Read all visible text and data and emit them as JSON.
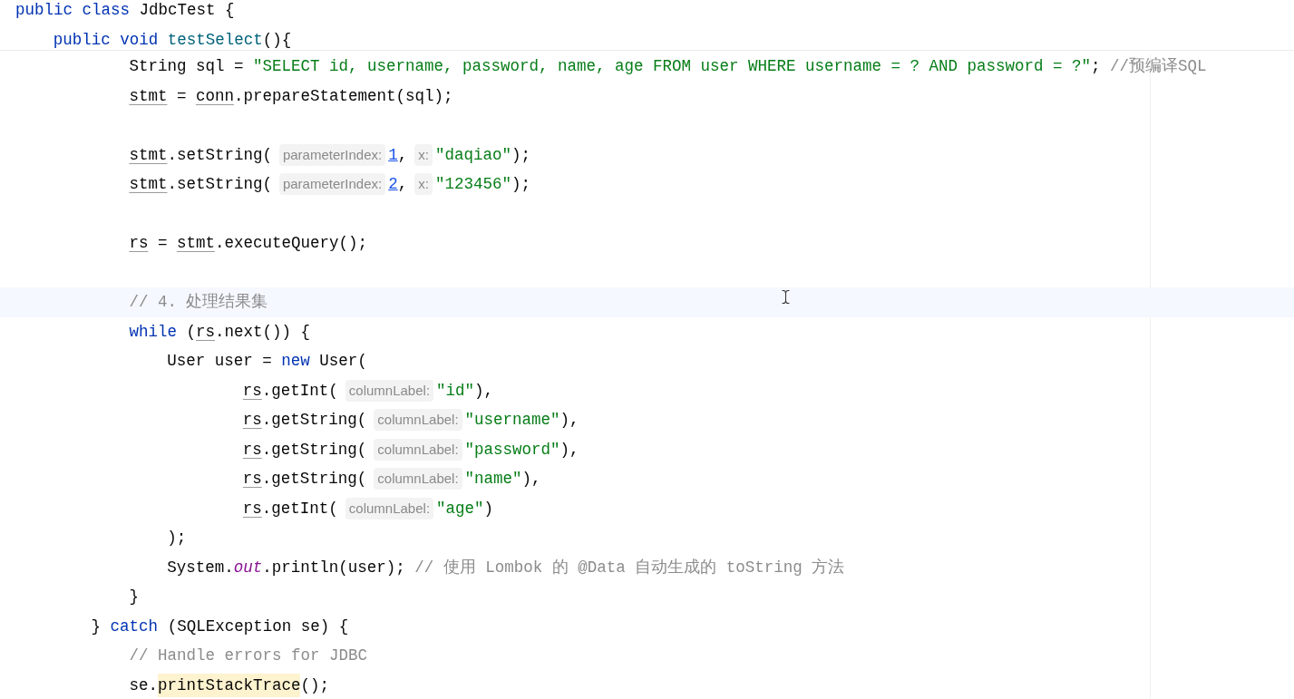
{
  "sticky_header": [
    {
      "kind": "code",
      "tokens": [
        {
          "kind": "kw",
          "text": "public class"
        },
        {
          "kind": "txt",
          "text": " JdbcTest {"
        }
      ],
      "children": [
        {
          "kind": "code",
          "tokens": [
            {
              "kind": "kw",
              "text": "public void "
            },
            {
              "kind": "fn",
              "text": "testSelect"
            },
            {
              "kind": "txt",
              "text": "(){"
            }
          ]
        }
      ]
    }
  ],
  "code": [
    {
      "kind": "group",
      "children": [
        {
          "kind": "code",
          "current": false,
          "tokens": [
            {
              "kind": "txt",
              "text": "String sql = "
            },
            {
              "kind": "str",
              "text": "\"SELECT id, username, password, name, age FROM user WHERE username = ? AND password = ?\""
            },
            {
              "kind": "txt",
              "text": "; "
            },
            {
              "kind": "cmt",
              "text": "//预编译SQL"
            }
          ]
        },
        {
          "kind": "code",
          "current": false,
          "tokens": [
            {
              "kind": "var",
              "text": "stmt"
            },
            {
              "kind": "txt",
              "text": " = "
            },
            {
              "kind": "var",
              "text": "conn"
            },
            {
              "kind": "txt",
              "text": ".prepareStatement(sql);"
            }
          ]
        },
        {
          "kind": "blank"
        },
        {
          "kind": "code",
          "current": false,
          "tokens": [
            {
              "kind": "var",
              "text": "stmt"
            },
            {
              "kind": "txt",
              "text": ".setString("
            },
            {
              "kind": "hint",
              "text": "parameterIndex:"
            },
            {
              "kind": "num",
              "text": "1"
            },
            {
              "kind": "txt",
              "text": ","
            },
            {
              "kind": "hint",
              "text": "x:"
            },
            {
              "kind": "str",
              "text": "\"daqiao\""
            },
            {
              "kind": "txt",
              "text": ");"
            }
          ]
        },
        {
          "kind": "code",
          "current": false,
          "tokens": [
            {
              "kind": "var",
              "text": "stmt"
            },
            {
              "kind": "txt",
              "text": ".setString("
            },
            {
              "kind": "hint",
              "text": "parameterIndex:"
            },
            {
              "kind": "num",
              "text": "2"
            },
            {
              "kind": "txt",
              "text": ","
            },
            {
              "kind": "hint",
              "text": "x:"
            },
            {
              "kind": "str",
              "text": "\"123456\""
            },
            {
              "kind": "txt",
              "text": ");"
            }
          ]
        },
        {
          "kind": "blank"
        },
        {
          "kind": "code",
          "current": false,
          "tokens": [
            {
              "kind": "var",
              "text": "rs"
            },
            {
              "kind": "txt",
              "text": " = "
            },
            {
              "kind": "var",
              "text": "stmt"
            },
            {
              "kind": "txt",
              "text": ".executeQuery();"
            }
          ]
        },
        {
          "kind": "blank"
        },
        {
          "kind": "code",
          "current": true,
          "tokens": [
            {
              "kind": "cmt",
              "text": "// 4. 处理结果集"
            }
          ]
        },
        {
          "kind": "code",
          "current": false,
          "tokens": [
            {
              "kind": "kw",
              "text": "while"
            },
            {
              "kind": "txt",
              "text": " ("
            },
            {
              "kind": "var",
              "text": "rs"
            },
            {
              "kind": "txt",
              "text": ".next()) {"
            }
          ],
          "children": [
            {
              "kind": "code",
              "current": false,
              "tokens": [
                {
                  "kind": "txt",
                  "text": "User user = "
                },
                {
                  "kind": "kw",
                  "text": "new"
                },
                {
                  "kind": "txt",
                  "text": " User("
                }
              ],
              "children": [
                {
                  "kind": "group",
                  "children": [
                    {
                      "kind": "code",
                      "current": false,
                      "tokens": [
                        {
                          "kind": "var",
                          "text": "rs"
                        },
                        {
                          "kind": "txt",
                          "text": ".getInt("
                        },
                        {
                          "kind": "hint",
                          "text": "columnLabel:"
                        },
                        {
                          "kind": "str",
                          "text": "\"id\""
                        },
                        {
                          "kind": "txt",
                          "text": "),"
                        }
                      ]
                    },
                    {
                      "kind": "code",
                      "current": false,
                      "tokens": [
                        {
                          "kind": "var",
                          "text": "rs"
                        },
                        {
                          "kind": "txt",
                          "text": ".getString("
                        },
                        {
                          "kind": "hint",
                          "text": "columnLabel:"
                        },
                        {
                          "kind": "str",
                          "text": "\"username\""
                        },
                        {
                          "kind": "txt",
                          "text": "),"
                        }
                      ]
                    },
                    {
                      "kind": "code",
                      "current": false,
                      "tokens": [
                        {
                          "kind": "var",
                          "text": "rs"
                        },
                        {
                          "kind": "txt",
                          "text": ".getString("
                        },
                        {
                          "kind": "hint",
                          "text": "columnLabel:"
                        },
                        {
                          "kind": "str",
                          "text": "\"password\""
                        },
                        {
                          "kind": "txt",
                          "text": "),"
                        }
                      ]
                    },
                    {
                      "kind": "code",
                      "current": false,
                      "tokens": [
                        {
                          "kind": "var",
                          "text": "rs"
                        },
                        {
                          "kind": "txt",
                          "text": ".getString("
                        },
                        {
                          "kind": "hint",
                          "text": "columnLabel:"
                        },
                        {
                          "kind": "str",
                          "text": "\"name\""
                        },
                        {
                          "kind": "txt",
                          "text": "),"
                        }
                      ]
                    },
                    {
                      "kind": "code",
                      "current": false,
                      "tokens": [
                        {
                          "kind": "var",
                          "text": "rs"
                        },
                        {
                          "kind": "txt",
                          "text": ".getInt("
                        },
                        {
                          "kind": "hint",
                          "text": "columnLabel:"
                        },
                        {
                          "kind": "str",
                          "text": "\"age\""
                        },
                        {
                          "kind": "txt",
                          "text": ")"
                        }
                      ]
                    }
                  ]
                }
              ]
            },
            {
              "kind": "code",
              "current": false,
              "tokens": [
                {
                  "kind": "txt",
                  "text": ");"
                }
              ]
            },
            {
              "kind": "code",
              "current": false,
              "tokens": [
                {
                  "kind": "txt",
                  "text": "System."
                },
                {
                  "kind": "fld",
                  "text": "out"
                },
                {
                  "kind": "txt",
                  "text": ".println(user); "
                },
                {
                  "kind": "cmt",
                  "text": "// 使用 Lombok 的 @Data 自动生成的 toString 方法"
                }
              ]
            }
          ]
        },
        {
          "kind": "code",
          "current": false,
          "tokens": [
            {
              "kind": "txt",
              "text": "}"
            }
          ]
        }
      ]
    },
    {
      "kind": "code",
      "current": false,
      "tokens": [
        {
          "kind": "txt",
          "text": "} "
        },
        {
          "kind": "kw",
          "text": "catch"
        },
        {
          "kind": "txt",
          "text": " (SQLException se) {"
        }
      ],
      "children": [
        {
          "kind": "code",
          "current": false,
          "tokens": [
            {
              "kind": "cmt",
              "text": "// Handle errors for JDBC"
            }
          ]
        },
        {
          "kind": "code",
          "current": false,
          "tokens": [
            {
              "kind": "txt",
              "text": "se."
            },
            {
              "kind": "hl",
              "text": "printStackTrace"
            },
            {
              "kind": "txt",
              "text": "();"
            }
          ]
        }
      ]
    }
  ]
}
